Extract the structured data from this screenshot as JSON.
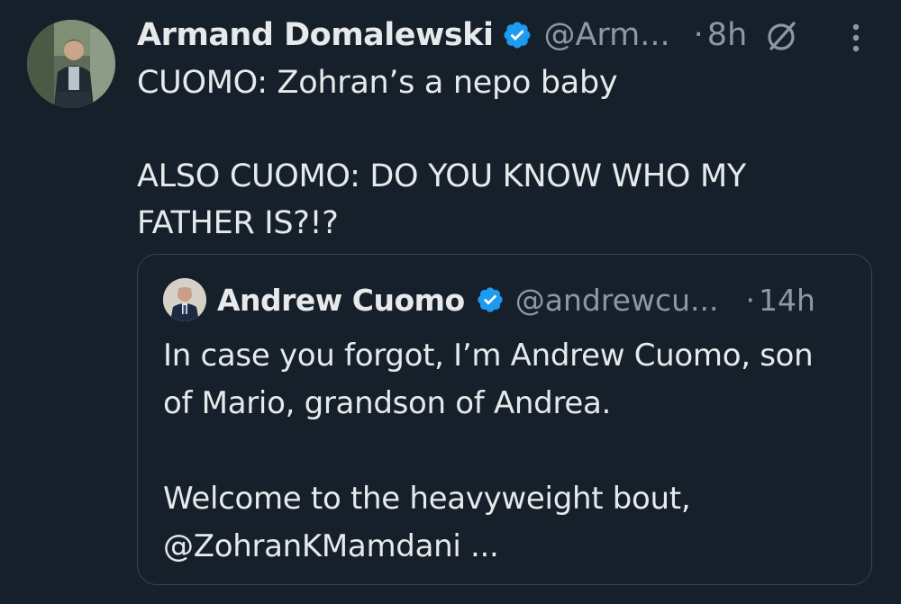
{
  "tweet": {
    "author_name": "Armand Domalewski",
    "author_handle": "@Arm...",
    "separator": "·",
    "time": "8h",
    "text": "CUOMO: Zohran’s a nepo baby\n\nALSO CUOMO: DO YOU KNOW WHO MY\nFATHER IS?!?",
    "verified_color": "#1d9bf0"
  },
  "quoted_tweet": {
    "author_name": "Andrew Cuomo",
    "author_handle": "@andrewcu...",
    "separator": "·",
    "time": "14h",
    "text": "In case you forgot, I’m Andrew Cuomo, son\nof Mario, grandson of Andrea.\n\nWelcome to the heavyweight bout,\n@ZohranKMamdani ..."
  },
  "icons": {
    "verified": "verified-badge-icon",
    "grok": "grok-icon",
    "more": "more-vertical-icon"
  },
  "colors": {
    "background": "#15202b",
    "text": "#e7e9ea",
    "muted": "#8b98a5",
    "border": "#38444d",
    "accent": "#1d9bf0"
  }
}
